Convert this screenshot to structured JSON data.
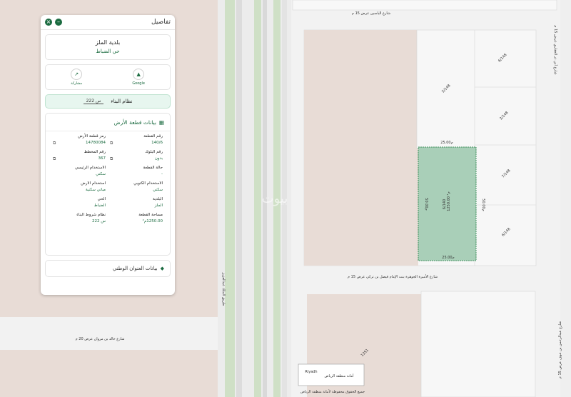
{
  "panel": {
    "title": "تفاصيل",
    "municipality": {
      "name": "بلدية الملز",
      "district": "حي الضباط"
    },
    "actions": [
      {
        "label": "Google",
        "icon": "map-pin-icon"
      },
      {
        "label": "مشاركة",
        "icon": "share-icon"
      }
    ],
    "building_system": {
      "label": "نظام البناء",
      "value": "س 222"
    },
    "land_section": {
      "title": "بيانات قطعة الأرض",
      "fields": [
        {
          "label": "رقم القطعة",
          "value": "140/6"
        },
        {
          "label": "رمز قطعة الأرض",
          "value": "14780084"
        },
        {
          "label": "رقم البلوك",
          "value": "بدون"
        },
        {
          "label": "رقم المخطط",
          "value": "367"
        },
        {
          "label": "حالة القطعة",
          "value": "-"
        },
        {
          "label": "الاستخدام الرئيسي",
          "value": "سكني"
        },
        {
          "label": "الاستخدام الكتوبي",
          "value": "سكني"
        },
        {
          "label": "استخدام الارض",
          "value": "مباني سكنية"
        },
        {
          "label": "البلدية",
          "value": "الملز"
        },
        {
          "label": "الحي",
          "value": "الضباط"
        },
        {
          "label": "مساحة القطعة",
          "value": "1250.00م²"
        },
        {
          "label": "نظام شروط البناء",
          "value": "س 222"
        }
      ]
    },
    "address_section": {
      "title": "بيانات العنوان الوطني"
    }
  },
  "map": {
    "streets": {
      "top": "شارع الياسين عرض 15 م",
      "middle": "شارع الأميرة الجوهرة بنت الإمام فيصل بن تركي عرض 15 م",
      "left": "شارع خالد بن مروان عرض 20 م",
      "vertical_left": "طريق الملك عبدالعزيز",
      "right_top": "شارع أبي ذر الغفاري عرض 15 م",
      "right_bottom": "شارع عبدالرحمن بن عوف عرض 15 م"
    },
    "parcel": {
      "label": "1250.00 م²",
      "number": "6/140",
      "side_top": "25.00م",
      "side_bottom": "25.00م",
      "side_left": "50.00م",
      "side_right": "50.00م"
    },
    "lot_labels": [
      "6/148",
      "5/148",
      "3/148",
      "7/148",
      "6/148",
      "1351"
    ],
    "watermark": "بيوت",
    "footer": {
      "copyright": "جميع الحقوق محفوظة لأمانة منطقة الرياض",
      "logo_text": "أمانة منطقة الرياض",
      "gov_text": "Riyadh"
    }
  },
  "colors": {
    "accent": "#1b6b40",
    "parcel": "#a9cfb8",
    "block": "#e8dcd6"
  }
}
